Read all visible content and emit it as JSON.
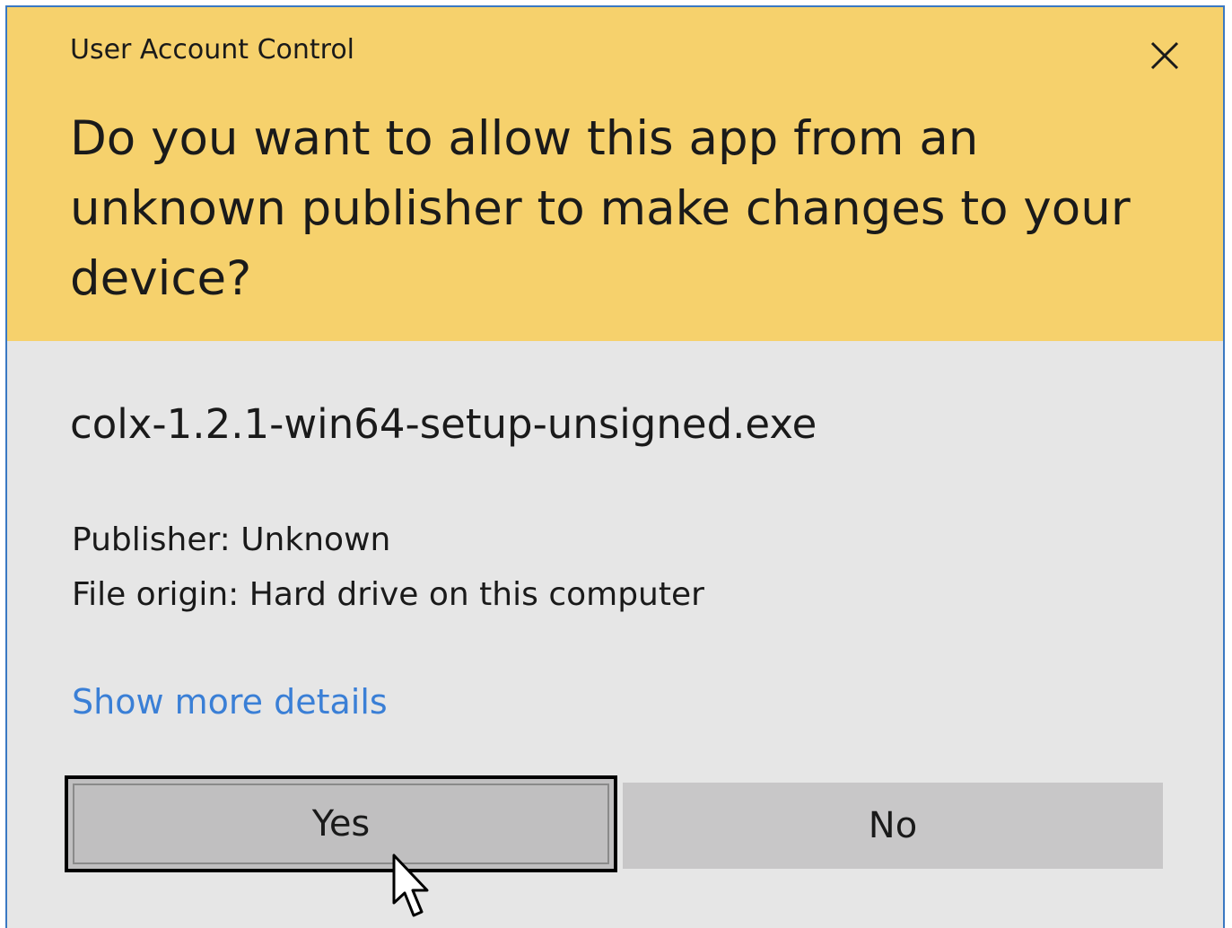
{
  "window": {
    "title": "User Account Control",
    "close_icon": "close-icon"
  },
  "prompt": {
    "question": "Do you want to allow this app from an unknown publisher to make changes to your device?",
    "app_name": "colx-1.2.1-win64-setup-unsigned.exe",
    "publisher": "Publisher: Unknown",
    "file_origin": "File origin: Hard drive on this computer",
    "details_link": "Show more details"
  },
  "buttons": {
    "yes_label": "Yes",
    "no_label": "No"
  },
  "colors": {
    "header_background": "#f6d16c",
    "body_background": "#e6e6e6",
    "link": "#3a7fd6",
    "button": "#c8c7c8",
    "window_border": "#3a78c2"
  },
  "cursor_icon": "mouse-pointer-icon"
}
